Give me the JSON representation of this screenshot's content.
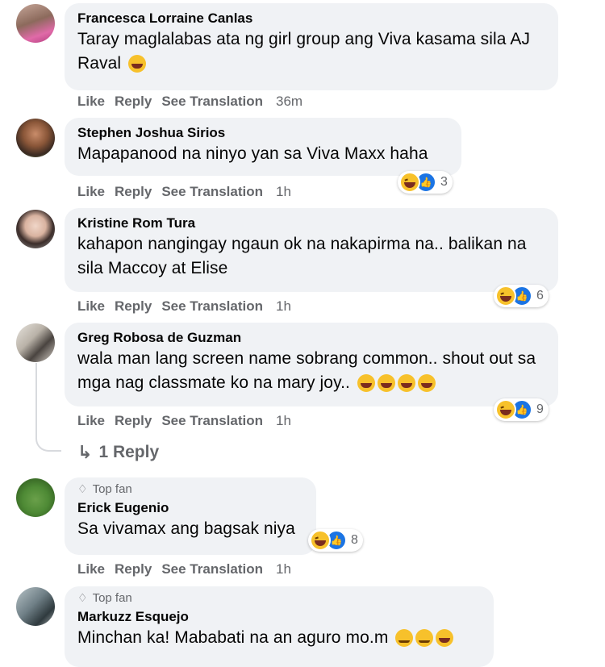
{
  "comments": [
    {
      "name": "Francesca Lorraine Canlas",
      "text": "Taray maglalabas ata ng girl group ang Viva kasama sila AJ Raval",
      "time": "36m"
    },
    {
      "name": "Stephen Joshua Sirios",
      "text": "Mapapanood na ninyo yan sa Viva Maxx haha",
      "time": "1h",
      "reaction_count": "3"
    },
    {
      "name": "Kristine Rom Tura",
      "text": "kahapon nangingay ngaun ok na nakapirma na.. balikan na sila Maccoy at Elise",
      "time": "1h",
      "reaction_count": "6"
    },
    {
      "name": "Greg Robosa de Guzman",
      "text": "wala man lang screen name sobrang common.. shout out sa mga nag classmate ko na mary joy..",
      "time": "1h",
      "reaction_count": "9"
    },
    {
      "badge": "Top fan",
      "name": "Erick Eugenio",
      "text": "Sa vivamax ang bagsak niya",
      "time": "1h",
      "reaction_count": "8"
    },
    {
      "badge": "Top fan",
      "name": "Markuzz Esquejo",
      "text": "Minchan ka! Mababati na an aguro mo.m"
    }
  ],
  "actions": {
    "like": "Like",
    "reply": "Reply",
    "translate": "See Translation"
  },
  "reply_link": "1 Reply",
  "colors": {
    "bubble": "#f0f2f5",
    "muted": "#65676b",
    "like_blue": "#1b74e4",
    "haha_yellow": "#f7c12b"
  }
}
